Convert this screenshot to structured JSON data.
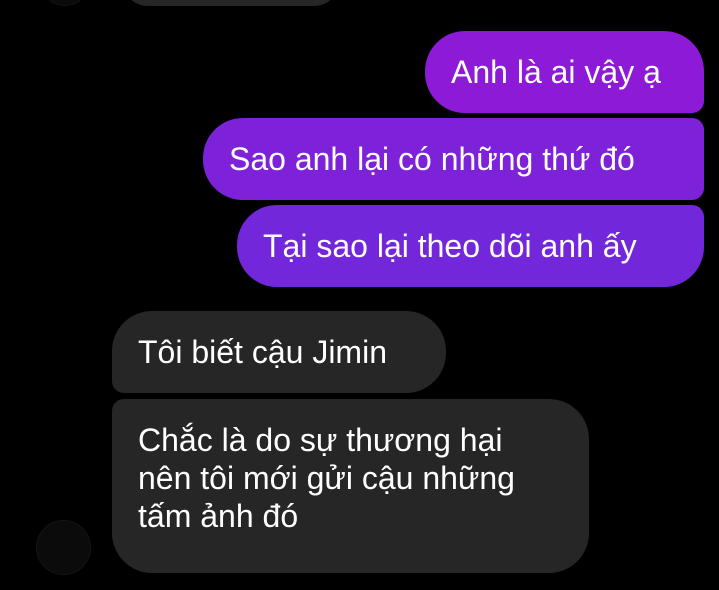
{
  "conversation": {
    "sent_messages": [
      {
        "text": "Anh là ai vậy ạ"
      },
      {
        "text": "Sao anh lại có những thứ đó"
      },
      {
        "text": "Tại sao lại theo dõi anh ấy"
      }
    ],
    "received_messages": [
      {
        "text": "Tôi biết cậu Jimin"
      },
      {
        "lines": [
          "Chắc là do sự thương hại",
          "nên tôi mới gửi cậu những",
          "tấm ảnh đó"
        ]
      }
    ]
  },
  "colors": {
    "background": "#000000",
    "sent_bubble_top": "#8c1ad6",
    "sent_bubble_bottom": "#7327db",
    "received_bubble": "#262626",
    "text": "#ffffff"
  }
}
